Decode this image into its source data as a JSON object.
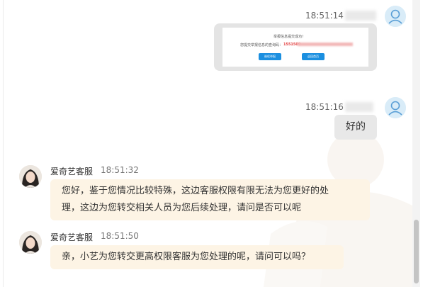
{
  "messages": {
    "m1": {
      "time": "18:51:14"
    },
    "m2": {
      "time": "18:51:16",
      "text": "好的"
    },
    "m3": {
      "sender": "爱奇艺客服",
      "time": "18:51:32",
      "line1": "您好，鉴于您情况比较特殊，这边客服权限有限无法为您更好的处",
      "line2": "理，这边为您转交相关人员为您后续处理，请问是否可以呢"
    },
    "m4": {
      "sender": "爱奇艺客服",
      "time": "18:51:50",
      "text": "亲，小艺为您转交更高权限客服为您处理的呢，请问可以吗？"
    }
  },
  "screenshot": {
    "title": "举报信息提交成功！",
    "query_label": "您提交举报信息的查询码：",
    "query_code": "1551509",
    "button_primary": "继续举报",
    "button_secondary": "返回首页"
  },
  "colors": {
    "accent": "#1b8fe0",
    "agent_bubble": "#fdf4e5",
    "user_bubble": "#e8e8e8"
  },
  "icons": {
    "user_avatar": "user-avatar-icon",
    "agent_avatar": "agent-avatar-icon"
  }
}
